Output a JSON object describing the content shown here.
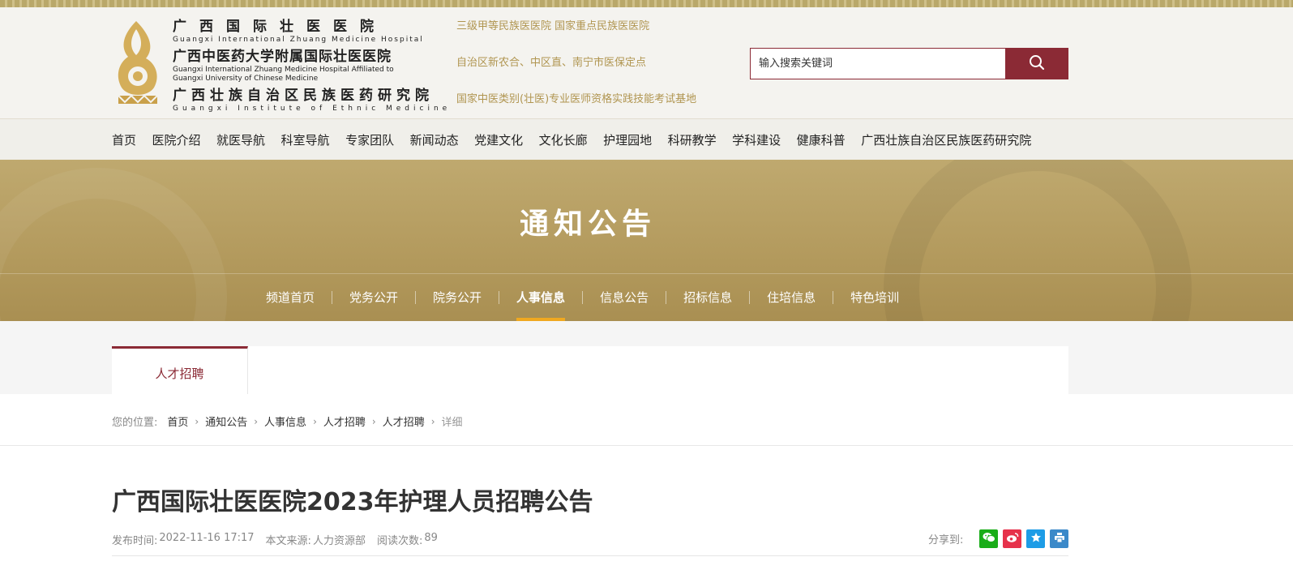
{
  "header": {
    "hospital_name_1_cn": "广西国际壮医医院",
    "hospital_name_1_en": "Guangxi International Zhuang Medicine Hospital",
    "hospital_name_2_cn": "广西中医药大学附属国际壮医医院",
    "hospital_name_2_en_line1": "Guangxi International Zhuang Medicine Hospital Affiliated to",
    "hospital_name_2_en_line2": "Guangxi University of Chinese Medicine",
    "hospital_name_3_cn": "广西壮族自治区民族医药研究院",
    "hospital_name_3_en": "Guangxi Institute of Ethnic Medicine",
    "taglines": [
      "三级甲等民族医医院   国家重点民族医医院",
      "自治区新农合、中区直、南宁市医保定点",
      "国家中医类别(壮医)专业医师资格实践技能考试基地"
    ],
    "search_placeholder": "输入搜索关键词"
  },
  "nav": {
    "items": [
      "首页",
      "医院介绍",
      "就医导航",
      "科室导航",
      "专家团队",
      "新闻动态",
      "党建文化",
      "文化长廊",
      "护理园地",
      "科研教学",
      "学科建设",
      "健康科普",
      "广西壮族自治区民族医药研究院"
    ]
  },
  "banner": {
    "title": "通知公告",
    "subnav": [
      "频道首页",
      "党务公开",
      "院务公开",
      "人事信息",
      "信息公告",
      "招标信息",
      "住培信息",
      "特色培训"
    ],
    "active_subnav": "人事信息"
  },
  "tab": {
    "label": "人才招聘"
  },
  "breadcrumb": {
    "label": "您的位置:",
    "items": [
      "首页",
      "通知公告",
      "人事信息",
      "人才招聘",
      "人才招聘",
      "详细"
    ]
  },
  "article": {
    "title": "广西国际壮医医院2023年护理人员招聘公告",
    "publish_label": "发布时间:",
    "publish_time": "2022-11-16 17:17",
    "source_label": "本文来源:",
    "source": "人力资源部",
    "views_label": "阅读次数:",
    "views": "89",
    "share_label": "分享到:"
  },
  "colors": {
    "brand": "#8b2a35",
    "gold": "#b39a5d",
    "active_underline": "#f0a820"
  },
  "icons": {
    "search": "search-icon",
    "share": [
      "wechat-icon",
      "weibo-icon",
      "qzone-icon",
      "print-icon"
    ]
  }
}
